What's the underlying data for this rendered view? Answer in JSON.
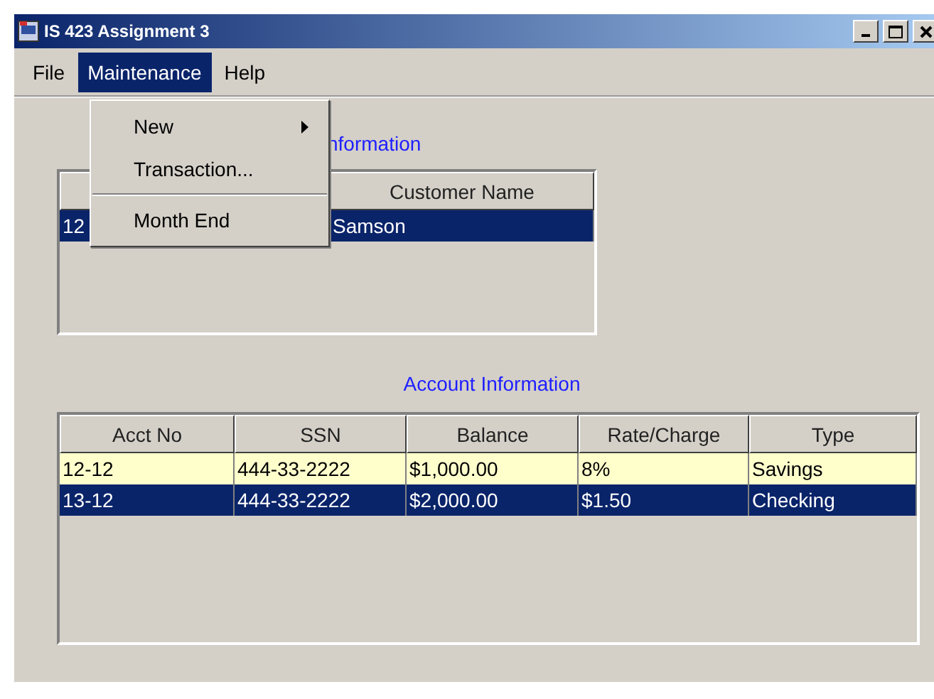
{
  "window": {
    "title": "IS 423 Assignment 3"
  },
  "menu_bar": [
    {
      "label": "File",
      "selected": false
    },
    {
      "label": "Maintenance",
      "selected": true
    },
    {
      "label": "Help",
      "selected": false
    }
  ],
  "dropdown": [
    {
      "kind": "item",
      "label": "New",
      "submenu": true
    },
    {
      "kind": "item",
      "label": "Transaction...",
      "submenu": false
    },
    {
      "kind": "separator"
    },
    {
      "kind": "item",
      "label": "Month End",
      "submenu": false
    }
  ],
  "customer_section": {
    "title": "nformation",
    "columns": [
      {
        "label": "Customer Name"
      }
    ],
    "rows": [
      {
        "cells": [
          "12",
          "Samson"
        ],
        "selected": true
      }
    ]
  },
  "account_section": {
    "title": "Account Information",
    "columns": [
      "Acct No",
      "SSN",
      "Balance",
      "Rate/Charge",
      "Type"
    ],
    "rows": [
      {
        "cells": [
          "12-12",
          "444-33-2222",
          "$1,000.00",
          "8%",
          "Savings"
        ],
        "selected": false,
        "highlighted": true
      },
      {
        "cells": [
          "13-12",
          "444-33-2222",
          "$2,000.00",
          "$1.50",
          "Checking"
        ],
        "selected": true,
        "highlighted": false
      }
    ]
  }
}
